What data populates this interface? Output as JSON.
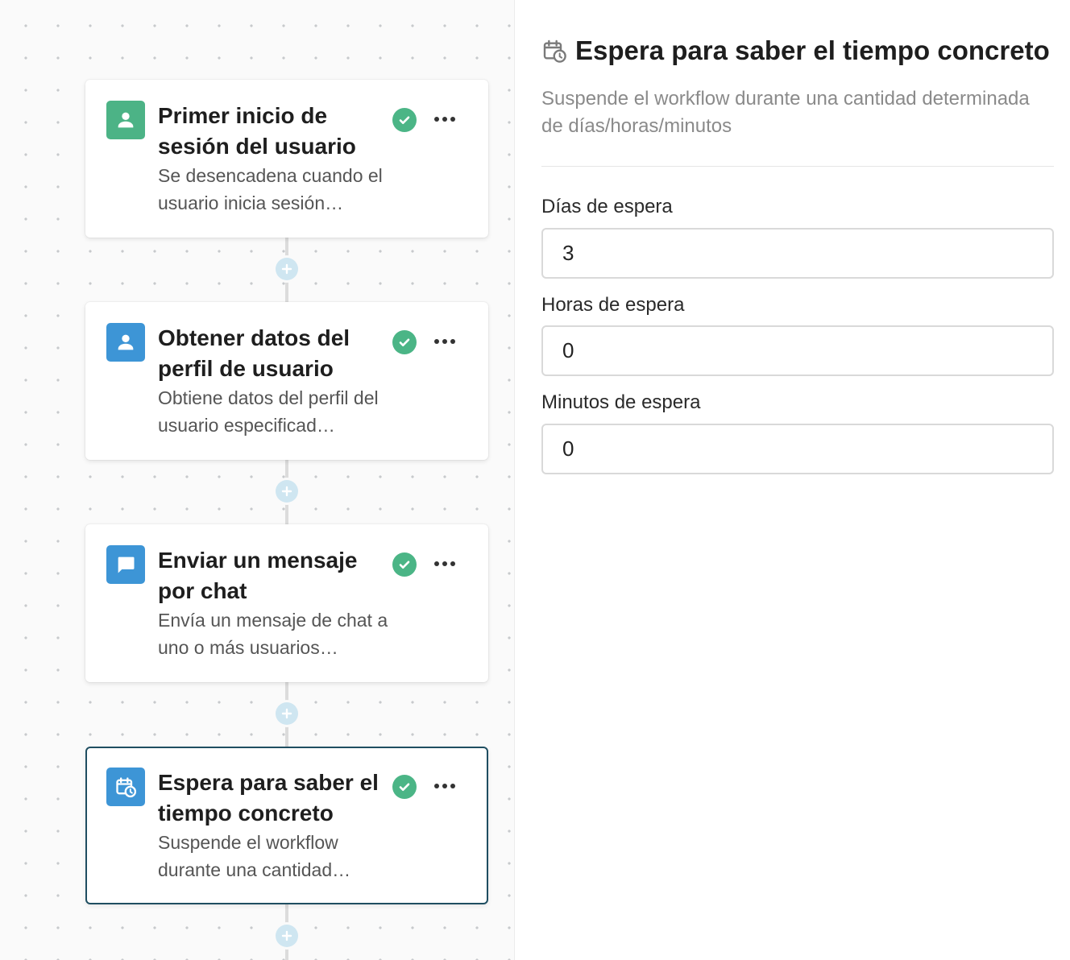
{
  "workflow": {
    "nodes": [
      {
        "title": "Primer inicio de sesión del usuario",
        "description": "Se desencadena cuando el usuario inicia sesión…",
        "icon": "user-icon",
        "icon_color": "#4cb386",
        "status": "check-icon",
        "selected": false
      },
      {
        "title": "Obtener datos del perfil de usuario",
        "description": "Obtiene datos del perfil del usuario especificad…",
        "icon": "user-icon",
        "icon_color": "#3d95d6",
        "status": "check-icon",
        "selected": false
      },
      {
        "title": "Enviar un mensaje por chat",
        "description": "Envía un mensaje de chat a uno o más usuarios…",
        "icon": "chat-icon",
        "icon_color": "#3d95d6",
        "status": "check-icon",
        "selected": false
      },
      {
        "title": "Espera para saber el tiempo concreto",
        "description": "Suspende el workflow durante una cantidad…",
        "icon": "calendar-clock-icon",
        "icon_color": "#3d95d6",
        "status": "check-icon",
        "selected": true
      }
    ]
  },
  "panel": {
    "title": "Espera para saber el tiempo concreto",
    "title_icon": "calendar-clock-icon",
    "subtitle": "Suspende el workflow durante una cantidad determinada de días/horas/minutos",
    "fields": [
      {
        "label": "Días de espera",
        "value": "3"
      },
      {
        "label": "Horas de espera",
        "value": "0"
      },
      {
        "label": "Minutos de espera",
        "value": "0"
      }
    ]
  },
  "colors": {
    "success": "#4bb586",
    "selected_border": "#1f4e61",
    "add_button": "#cfe6f1",
    "add_button_plus": "#ffffff"
  }
}
